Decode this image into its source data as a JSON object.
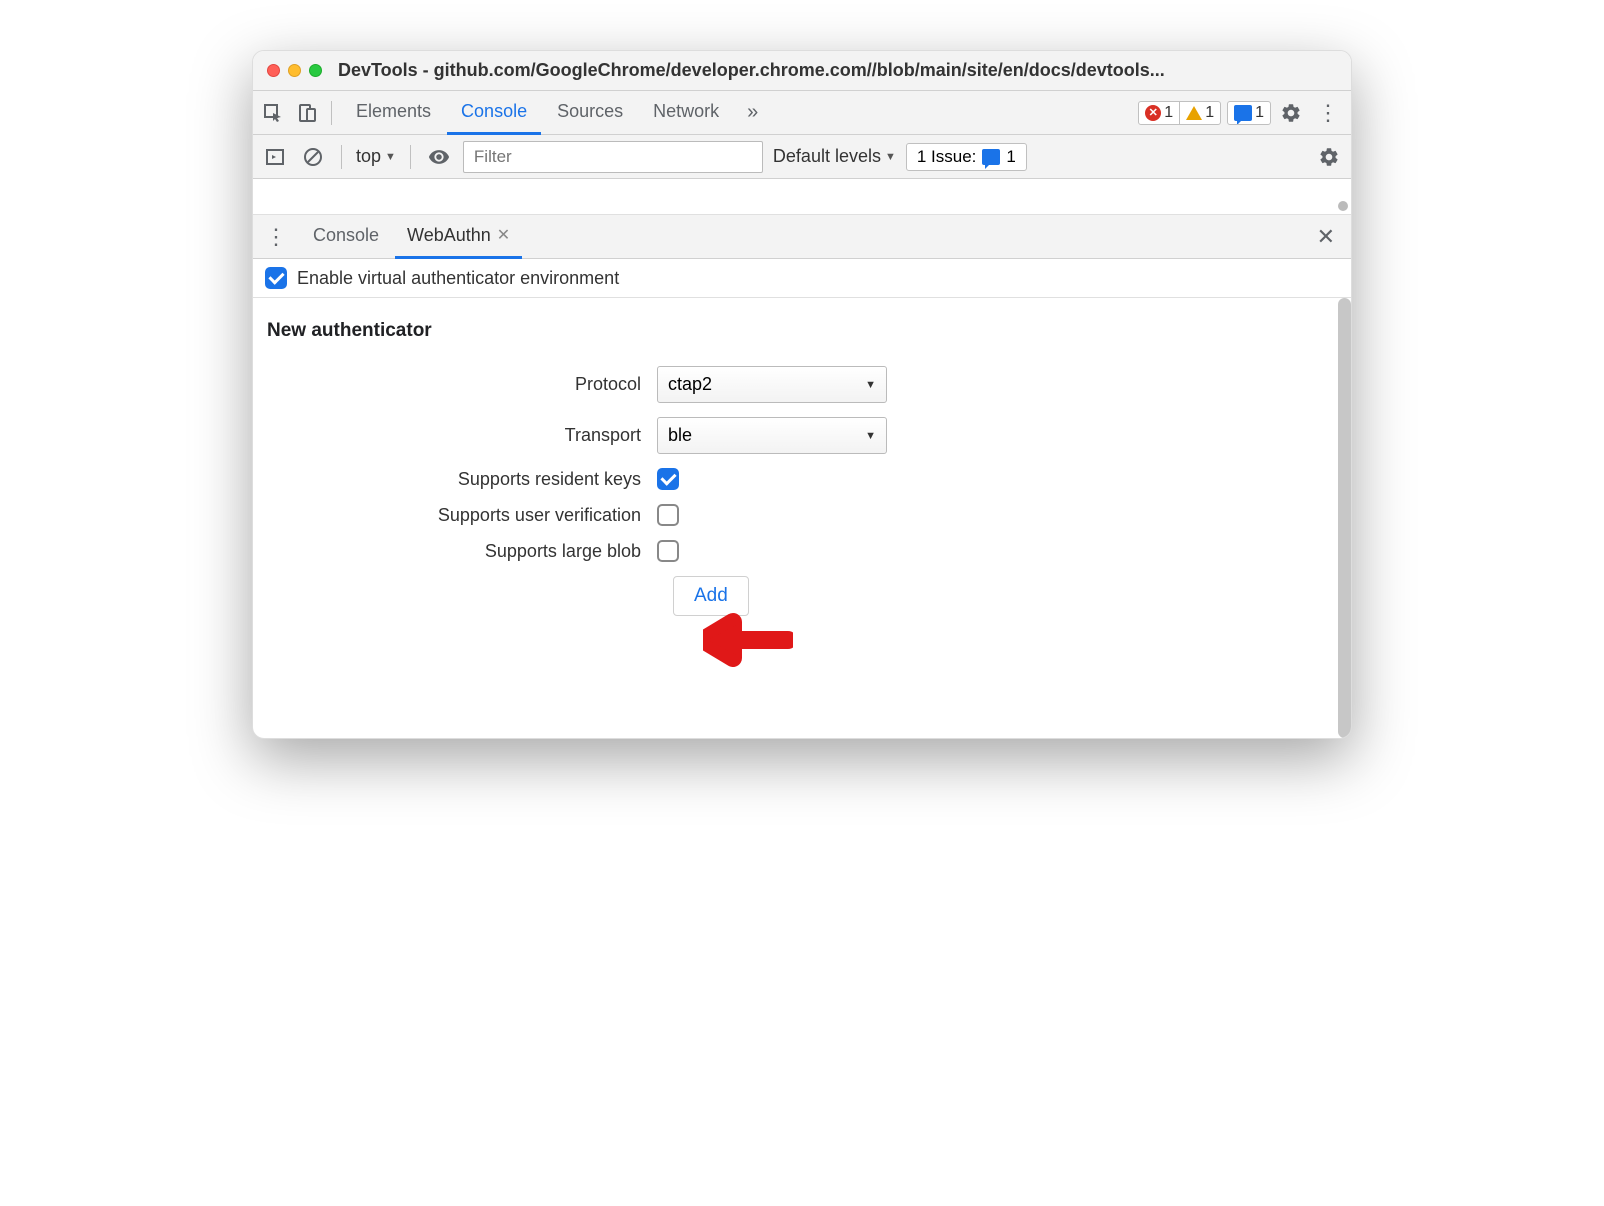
{
  "window": {
    "title": "DevTools - github.com/GoogleChrome/developer.chrome.com//blob/main/site/en/docs/devtools..."
  },
  "mainTabs": {
    "elements": "Elements",
    "console": "Console",
    "sources": "Sources",
    "network": "Network"
  },
  "badges": {
    "errors": "1",
    "warnings": "1",
    "messages": "1"
  },
  "consoleBar": {
    "context": "top",
    "filterPlaceholder": "Filter",
    "levels": "Default levels",
    "issuesLabel": "1 Issue:",
    "issuesCount": "1"
  },
  "drawer": {
    "tabs": {
      "console": "Console",
      "webauthn": "WebAuthn"
    },
    "enableLabel": "Enable virtual authenticator environment",
    "enableChecked": true
  },
  "form": {
    "heading": "New authenticator",
    "protocolLabel": "Protocol",
    "protocolValue": "ctap2",
    "transportLabel": "Transport",
    "transportValue": "ble",
    "residentKeysLabel": "Supports resident keys",
    "residentKeysChecked": true,
    "userVerifyLabel": "Supports user verification",
    "userVerifyChecked": false,
    "largeBlobLabel": "Supports large blob",
    "largeBlobChecked": false,
    "addButton": "Add"
  }
}
